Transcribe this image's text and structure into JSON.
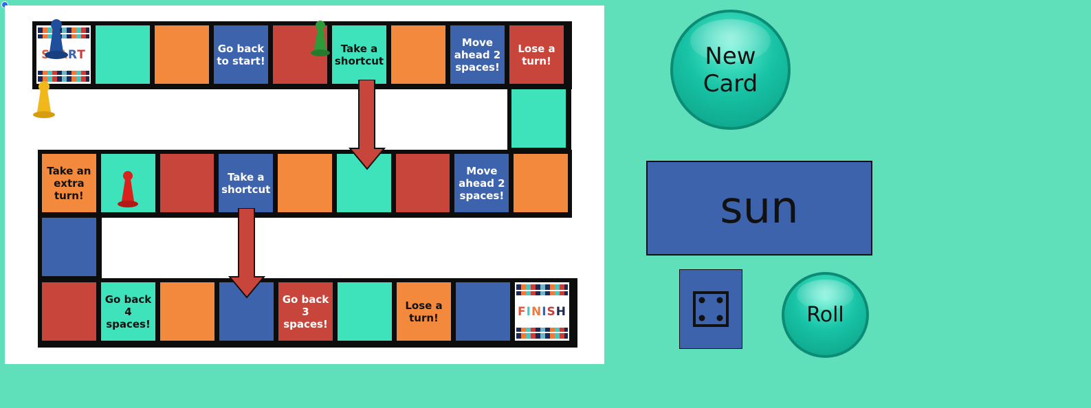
{
  "board": {
    "row1": [
      {
        "type": "start",
        "label": "START",
        "color": "special"
      },
      {
        "label": "",
        "color": "teal"
      },
      {
        "label": "",
        "color": "orange"
      },
      {
        "label": "Go back to start!",
        "color": "blue"
      },
      {
        "label": "",
        "color": "red"
      },
      {
        "label": "Take a shortcut",
        "color": "teal"
      },
      {
        "label": "",
        "color": "orange"
      },
      {
        "label": "Move ahead 2 spaces!",
        "color": "blue"
      },
      {
        "label": "Lose a turn!",
        "color": "red"
      }
    ],
    "connector_right": {
      "label": "",
      "color": "teal"
    },
    "row2": [
      {
        "label": "Take an extra turn!",
        "color": "orange"
      },
      {
        "label": "",
        "color": "teal"
      },
      {
        "label": "",
        "color": "red"
      },
      {
        "label": "Take a shortcut",
        "color": "blue"
      },
      {
        "label": "",
        "color": "orange"
      },
      {
        "label": "",
        "color": "teal"
      },
      {
        "label": "",
        "color": "red"
      },
      {
        "label": "Move ahead 2 spaces!",
        "color": "blue"
      },
      {
        "label": "",
        "color": "orange"
      }
    ],
    "connector_left": {
      "label": "",
      "color": "blue"
    },
    "row3": [
      {
        "label": "",
        "color": "red"
      },
      {
        "label": "Go back 4 spaces!",
        "color": "teal"
      },
      {
        "label": "",
        "color": "orange"
      },
      {
        "label": "",
        "color": "blue"
      },
      {
        "label": "Go back 3 spaces!",
        "color": "red"
      },
      {
        "label": "",
        "color": "teal"
      },
      {
        "label": "Lose a turn!",
        "color": "orange"
      },
      {
        "label": "",
        "color": "blue"
      },
      {
        "type": "finish",
        "label": "FINISH",
        "color": "special"
      }
    ],
    "pawns": [
      {
        "name": "blue-pawn",
        "color": "#1f4e9c"
      },
      {
        "name": "green-pawn",
        "color": "#2f9a3a"
      },
      {
        "name": "yellow-pawn",
        "color": "#f1b81c"
      },
      {
        "name": "red-pawn",
        "color": "#d8221c"
      }
    ]
  },
  "controls": {
    "new_card_label": "New Card",
    "roll_label": "Roll",
    "current_card": "sun",
    "die_value": 4
  },
  "colors": {
    "background": "#5fe0bb",
    "teal": "#3ee3bc",
    "orange": "#f3893c",
    "red": "#c7453a",
    "blue": "#3d63ac"
  }
}
